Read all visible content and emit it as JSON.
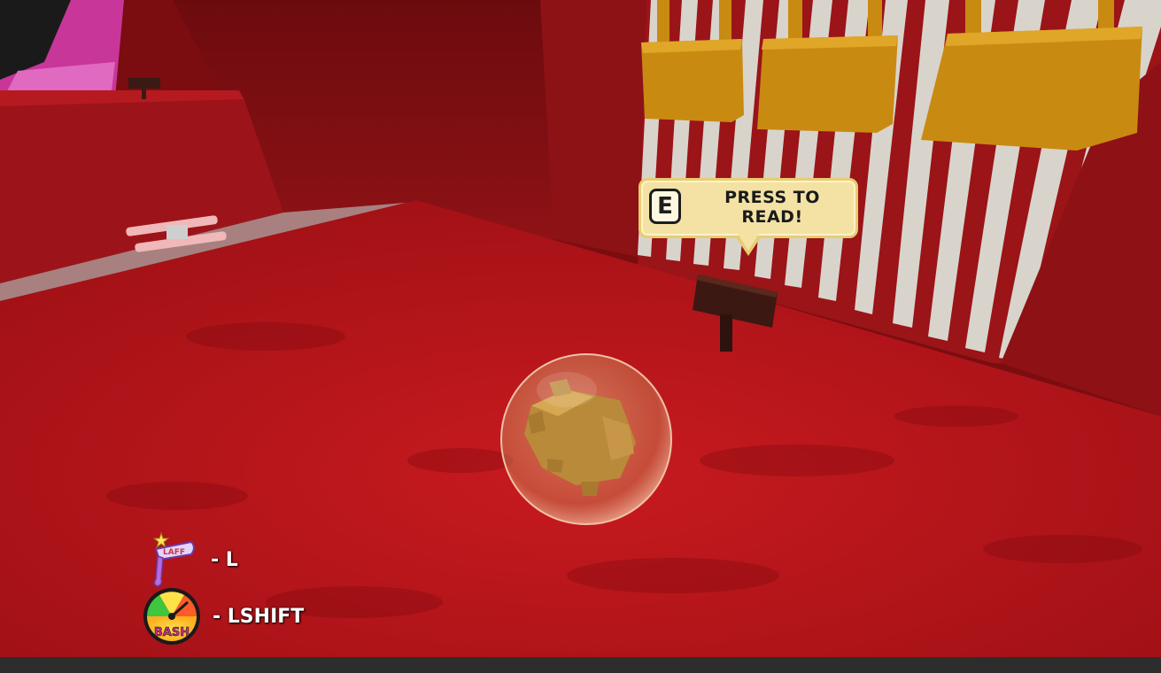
{
  "prompt": {
    "key": "E",
    "text_line1": "PRESS TO",
    "text_line2": "READ!"
  },
  "hud": {
    "ability_1": {
      "icon": "horn-icon",
      "label": "- L"
    },
    "ability_2": {
      "icon": "bash-meter-icon",
      "label": "- LSHIFT",
      "gauge_text": "BASH"
    }
  },
  "colors": {
    "floor": "#b3141a",
    "wall": "#8a1014",
    "bars_gold": "#c98a12",
    "fence_white": "#dcd8d0",
    "prompt_bg": "#f3e2a4"
  }
}
